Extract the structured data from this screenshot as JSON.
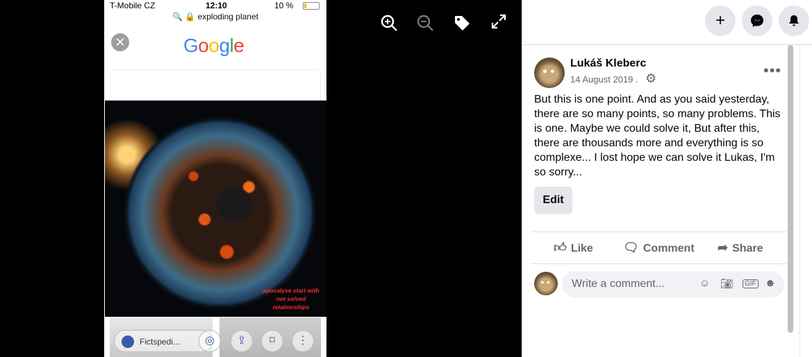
{
  "viewer": {
    "icons": [
      "zoom-in-icon",
      "zoom-out-icon",
      "tag-icon",
      "fullscreen-icon"
    ]
  },
  "phone": {
    "status": {
      "carrier": "T-Mobile CZ",
      "time": "12:10",
      "battery": "10 %"
    },
    "url": "exploding planet",
    "google_logo": "Google",
    "image_caption": "apocalyse start with not solved relationships",
    "pill_label": "Fictspedi..."
  },
  "fb": {
    "author": "Lukáš Kleberc",
    "date": "14 August 2019 .",
    "body": "But this is one point. And as you said yesterday, there are so many points, so many problems. This is one. Maybe we could solve it, But after this, there are thousands more and everything is so complexe... I lost hope we can solve it Lukas, I'm so sorry...",
    "edit_label": "Edit",
    "actions": {
      "like": "Like",
      "comment": "Comment",
      "share": "Share"
    },
    "comment_placeholder": "Write a comment..."
  }
}
